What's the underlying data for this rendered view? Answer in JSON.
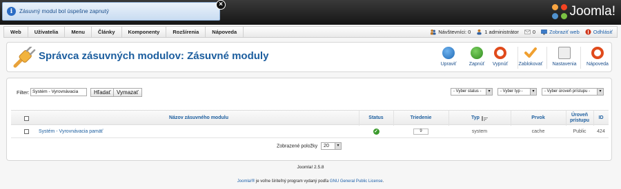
{
  "message": {
    "text": "Zásuvný modul bol úspešne zapnutý",
    "icon": "info-icon",
    "close": "×"
  },
  "brand": {
    "name": "Joomla!"
  },
  "menu": {
    "items": [
      "Web",
      "Užívatelia",
      "Menu",
      "Články",
      "Komponenty",
      "Rozšírenia",
      "Nápoveda"
    ]
  },
  "status": {
    "visitors": "Návštevníci: 0",
    "admins": "1 administrátor",
    "messages": "0",
    "view_site": "Zobraziť web",
    "logout": "Odhlásiť"
  },
  "page": {
    "title": "Správca zásuvných modulov: Zásuvné moduly"
  },
  "toolbar": {
    "edit": "Upraviť",
    "enable": "Zapnúť",
    "disable": "Vypnúť",
    "checkin": "Zablokovať",
    "options": "Nastavenia",
    "help": "Nápoveda"
  },
  "filter": {
    "label": "Filter:",
    "value": "Systém - Vyrovnávacia",
    "search": "Hľadať",
    "clear": "Vymazať",
    "status_select": "- Vyber status -",
    "type_select": "- Vyber typ -",
    "access_select": "- Vyber úroveň prístupu -"
  },
  "table": {
    "headers": {
      "name": "Názov zásuvného modulu",
      "status": "Status",
      "ordering": "Triedenie",
      "type": "Typ",
      "element": "Prvok",
      "access": "Úroveň prístupu",
      "id": "ID"
    },
    "rows": [
      {
        "name": "Systém - Vyrovnávacia pamäť",
        "ordering": "9",
        "type": "system",
        "element": "cache",
        "access": "Public",
        "id": "424"
      }
    ]
  },
  "pager": {
    "label": "Zobrazené položky",
    "value": "20"
  },
  "footer": {
    "version": "Joomla! 2.5.8",
    "joomla_link": "Joomla!®",
    "text": " je voľne šíriteľný program vydaný podľa ",
    "license": "GNU General Public License",
    "end": "."
  },
  "colors": {
    "accent": "#1b5d9e",
    "success": "#3b9a2c",
    "danger": "#e04a1b",
    "warning": "#f0a030"
  }
}
